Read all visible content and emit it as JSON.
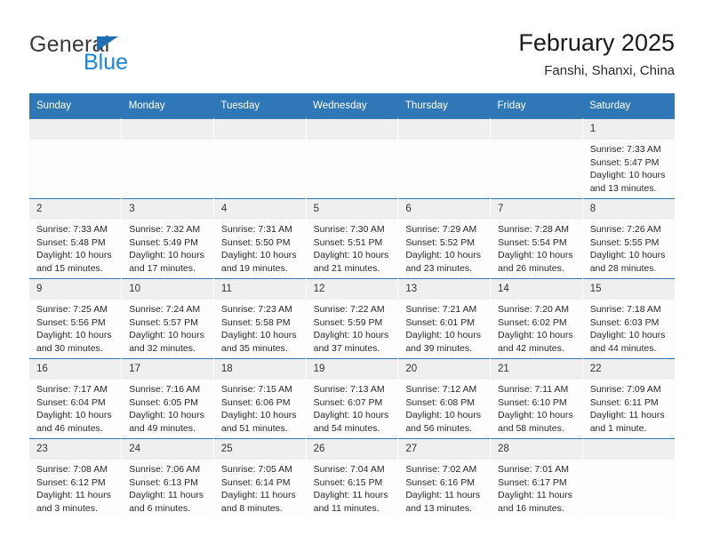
{
  "brand": {
    "name_part1": "General",
    "name_part2": "Blue",
    "triangle_color": "#1f6fb5",
    "blue_color": "#1c84d6"
  },
  "header": {
    "title": "February 2025",
    "subtitle": "Fanshi, Shanxi, China"
  },
  "colors": {
    "header_row_bg": "#3077b8",
    "daynum_bg": "#efefef",
    "cell_bg": "#fdfdfd",
    "text": "#2a2a2a"
  },
  "weekday_headers": [
    "Sunday",
    "Monday",
    "Tuesday",
    "Wednesday",
    "Thursday",
    "Friday",
    "Saturday"
  ],
  "weeks": [
    [
      {
        "day": "",
        "sunrise": "",
        "sunset": "",
        "daylight": "",
        "empty": true
      },
      {
        "day": "",
        "sunrise": "",
        "sunset": "",
        "daylight": "",
        "empty": true
      },
      {
        "day": "",
        "sunrise": "",
        "sunset": "",
        "daylight": "",
        "empty": true
      },
      {
        "day": "",
        "sunrise": "",
        "sunset": "",
        "daylight": "",
        "empty": true
      },
      {
        "day": "",
        "sunrise": "",
        "sunset": "",
        "daylight": "",
        "empty": true
      },
      {
        "day": "",
        "sunrise": "",
        "sunset": "",
        "daylight": "",
        "empty": true
      },
      {
        "day": "1",
        "sunrise": "Sunrise: 7:33 AM",
        "sunset": "Sunset: 5:47 PM",
        "daylight": "Daylight: 10 hours and 13 minutes.",
        "empty": false
      }
    ],
    [
      {
        "day": "2",
        "sunrise": "Sunrise: 7:33 AM",
        "sunset": "Sunset: 5:48 PM",
        "daylight": "Daylight: 10 hours and 15 minutes.",
        "empty": false
      },
      {
        "day": "3",
        "sunrise": "Sunrise: 7:32 AM",
        "sunset": "Sunset: 5:49 PM",
        "daylight": "Daylight: 10 hours and 17 minutes.",
        "empty": false
      },
      {
        "day": "4",
        "sunrise": "Sunrise: 7:31 AM",
        "sunset": "Sunset: 5:50 PM",
        "daylight": "Daylight: 10 hours and 19 minutes.",
        "empty": false
      },
      {
        "day": "5",
        "sunrise": "Sunrise: 7:30 AM",
        "sunset": "Sunset: 5:51 PM",
        "daylight": "Daylight: 10 hours and 21 minutes.",
        "empty": false
      },
      {
        "day": "6",
        "sunrise": "Sunrise: 7:29 AM",
        "sunset": "Sunset: 5:52 PM",
        "daylight": "Daylight: 10 hours and 23 minutes.",
        "empty": false
      },
      {
        "day": "7",
        "sunrise": "Sunrise: 7:28 AM",
        "sunset": "Sunset: 5:54 PM",
        "daylight": "Daylight: 10 hours and 26 minutes.",
        "empty": false
      },
      {
        "day": "8",
        "sunrise": "Sunrise: 7:26 AM",
        "sunset": "Sunset: 5:55 PM",
        "daylight": "Daylight: 10 hours and 28 minutes.",
        "empty": false
      }
    ],
    [
      {
        "day": "9",
        "sunrise": "Sunrise: 7:25 AM",
        "sunset": "Sunset: 5:56 PM",
        "daylight": "Daylight: 10 hours and 30 minutes.",
        "empty": false
      },
      {
        "day": "10",
        "sunrise": "Sunrise: 7:24 AM",
        "sunset": "Sunset: 5:57 PM",
        "daylight": "Daylight: 10 hours and 32 minutes.",
        "empty": false
      },
      {
        "day": "11",
        "sunrise": "Sunrise: 7:23 AM",
        "sunset": "Sunset: 5:58 PM",
        "daylight": "Daylight: 10 hours and 35 minutes.",
        "empty": false
      },
      {
        "day": "12",
        "sunrise": "Sunrise: 7:22 AM",
        "sunset": "Sunset: 5:59 PM",
        "daylight": "Daylight: 10 hours and 37 minutes.",
        "empty": false
      },
      {
        "day": "13",
        "sunrise": "Sunrise: 7:21 AM",
        "sunset": "Sunset: 6:01 PM",
        "daylight": "Daylight: 10 hours and 39 minutes.",
        "empty": false
      },
      {
        "day": "14",
        "sunrise": "Sunrise: 7:20 AM",
        "sunset": "Sunset: 6:02 PM",
        "daylight": "Daylight: 10 hours and 42 minutes.",
        "empty": false
      },
      {
        "day": "15",
        "sunrise": "Sunrise: 7:18 AM",
        "sunset": "Sunset: 6:03 PM",
        "daylight": "Daylight: 10 hours and 44 minutes.",
        "empty": false
      }
    ],
    [
      {
        "day": "16",
        "sunrise": "Sunrise: 7:17 AM",
        "sunset": "Sunset: 6:04 PM",
        "daylight": "Daylight: 10 hours and 46 minutes.",
        "empty": false
      },
      {
        "day": "17",
        "sunrise": "Sunrise: 7:16 AM",
        "sunset": "Sunset: 6:05 PM",
        "daylight": "Daylight: 10 hours and 49 minutes.",
        "empty": false
      },
      {
        "day": "18",
        "sunrise": "Sunrise: 7:15 AM",
        "sunset": "Sunset: 6:06 PM",
        "daylight": "Daylight: 10 hours and 51 minutes.",
        "empty": false
      },
      {
        "day": "19",
        "sunrise": "Sunrise: 7:13 AM",
        "sunset": "Sunset: 6:07 PM",
        "daylight": "Daylight: 10 hours and 54 minutes.",
        "empty": false
      },
      {
        "day": "20",
        "sunrise": "Sunrise: 7:12 AM",
        "sunset": "Sunset: 6:08 PM",
        "daylight": "Daylight: 10 hours and 56 minutes.",
        "empty": false
      },
      {
        "day": "21",
        "sunrise": "Sunrise: 7:11 AM",
        "sunset": "Sunset: 6:10 PM",
        "daylight": "Daylight: 10 hours and 58 minutes.",
        "empty": false
      },
      {
        "day": "22",
        "sunrise": "Sunrise: 7:09 AM",
        "sunset": "Sunset: 6:11 PM",
        "daylight": "Daylight: 11 hours and 1 minute.",
        "empty": false
      }
    ],
    [
      {
        "day": "23",
        "sunrise": "Sunrise: 7:08 AM",
        "sunset": "Sunset: 6:12 PM",
        "daylight": "Daylight: 11 hours and 3 minutes.",
        "empty": false
      },
      {
        "day": "24",
        "sunrise": "Sunrise: 7:06 AM",
        "sunset": "Sunset: 6:13 PM",
        "daylight": "Daylight: 11 hours and 6 minutes.",
        "empty": false
      },
      {
        "day": "25",
        "sunrise": "Sunrise: 7:05 AM",
        "sunset": "Sunset: 6:14 PM",
        "daylight": "Daylight: 11 hours and 8 minutes.",
        "empty": false
      },
      {
        "day": "26",
        "sunrise": "Sunrise: 7:04 AM",
        "sunset": "Sunset: 6:15 PM",
        "daylight": "Daylight: 11 hours and 11 minutes.",
        "empty": false
      },
      {
        "day": "27",
        "sunrise": "Sunrise: 7:02 AM",
        "sunset": "Sunset: 6:16 PM",
        "daylight": "Daylight: 11 hours and 13 minutes.",
        "empty": false
      },
      {
        "day": "28",
        "sunrise": "Sunrise: 7:01 AM",
        "sunset": "Sunset: 6:17 PM",
        "daylight": "Daylight: 11 hours and 16 minutes.",
        "empty": false
      },
      {
        "day": "",
        "sunrise": "",
        "sunset": "",
        "daylight": "",
        "empty": true
      }
    ]
  ]
}
